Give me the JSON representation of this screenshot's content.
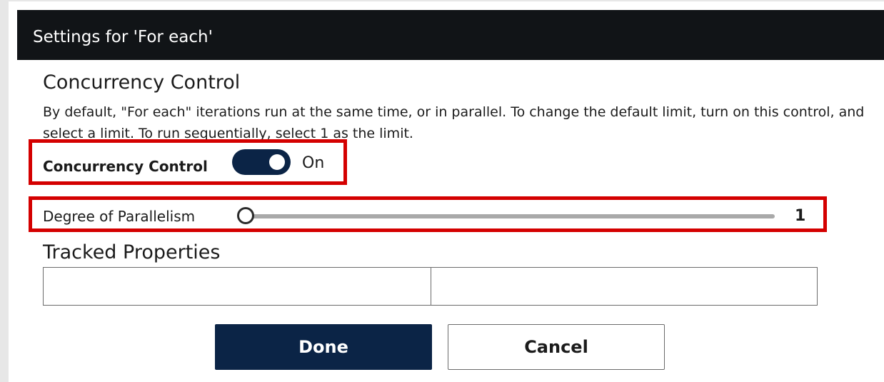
{
  "dialog": {
    "title": "Settings for 'For each'"
  },
  "concurrency": {
    "heading": "Concurrency Control",
    "description": "By default, \"For each\" iterations run at the same time, or in parallel. To change the default limit, turn on this control, and select a limit. To run sequentially, select 1 as the limit.",
    "toggle_label": "Concurrency Control",
    "toggle_state": "On",
    "toggle_on": true
  },
  "parallelism": {
    "label": "Degree of Parallelism",
    "value_text": "1",
    "fraction": 0.0
  },
  "tracked": {
    "heading": "Tracked Properties",
    "key_value": "",
    "value_value": ""
  },
  "buttons": {
    "done_label": "Done",
    "cancel_label": "Cancel"
  },
  "colors": {
    "accent": "#0b2446",
    "highlight": "#d40000",
    "titlebar": "#111417"
  }
}
